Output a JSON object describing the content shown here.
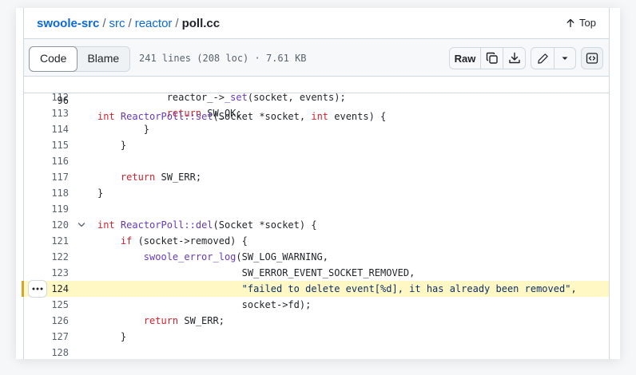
{
  "breadcrumb": {
    "repo": "swoole-src",
    "dir1": "src",
    "dir2": "reactor",
    "file": "poll.cc",
    "separator": "/"
  },
  "top_link": "Top",
  "toolbar": {
    "code_tab": "Code",
    "blame_tab": "Blame",
    "file_meta": "241 lines (208 loc) · 7.61 KB",
    "raw_label": "Raw"
  },
  "icons": [
    "arrow-up-icon",
    "copy-icon",
    "download-icon",
    "pencil-icon",
    "chevron-down-icon",
    "symbols-panel-icon",
    "chevron-down-icon",
    "kebab-dots-icon"
  ],
  "colors": {
    "link": "#0969da",
    "keyword": "#cf222e",
    "function": "#6639ba",
    "string": "#0a3069",
    "highlight_bg": "#fff8c5",
    "highlight_bar": "#d4a72c"
  },
  "sticky_line": {
    "number": "96",
    "tokens": [
      {
        "t": "int",
        "c": "kw"
      },
      {
        "t": " "
      },
      {
        "t": "ReactorPoll::set",
        "c": "fn"
      },
      {
        "t": "(Socket *socket, "
      },
      {
        "t": "int",
        "c": "kw"
      },
      {
        "t": " events) {"
      }
    ]
  },
  "highlighted_line": "124",
  "lines": [
    {
      "number": "112",
      "tokens": [
        {
          "t": "            reactor_->"
        },
        {
          "t": "_set",
          "c": "fn"
        },
        {
          "t": "(socket, events);"
        }
      ]
    },
    {
      "number": "113",
      "tokens": [
        {
          "t": "            "
        },
        {
          "t": "return",
          "c": "kw"
        },
        {
          "t": " SW_OK;"
        }
      ]
    },
    {
      "number": "114",
      "tokens": [
        {
          "t": "        }"
        }
      ]
    },
    {
      "number": "115",
      "tokens": [
        {
          "t": "    }"
        }
      ]
    },
    {
      "number": "116",
      "tokens": []
    },
    {
      "number": "117",
      "tokens": [
        {
          "t": "    "
        },
        {
          "t": "return",
          "c": "kw"
        },
        {
          "t": " SW_ERR;"
        }
      ]
    },
    {
      "number": "118",
      "tokens": [
        {
          "t": "}"
        }
      ]
    },
    {
      "number": "119",
      "tokens": []
    },
    {
      "number": "120",
      "fold": true,
      "tokens": [
        {
          "t": "int",
          "c": "kw"
        },
        {
          "t": " "
        },
        {
          "t": "ReactorPoll::del",
          "c": "fn"
        },
        {
          "t": "(Socket *socket) {"
        }
      ]
    },
    {
      "number": "121",
      "tokens": [
        {
          "t": "    "
        },
        {
          "t": "if",
          "c": "kw"
        },
        {
          "t": " (socket->removed) {"
        }
      ]
    },
    {
      "number": "122",
      "tokens": [
        {
          "t": "        "
        },
        {
          "t": "swoole_error_log",
          "c": "fn"
        },
        {
          "t": "(SW_LOG_WARNING,"
        }
      ]
    },
    {
      "number": "123",
      "tokens": [
        {
          "t": "                         SW_ERROR_EVENT_SOCKET_REMOVED,"
        }
      ]
    },
    {
      "number": "124",
      "tokens": [
        {
          "t": "                         "
        },
        {
          "t": "\"failed to delete event[%d], it has already been removed\"",
          "c": "st"
        },
        {
          "t": ","
        }
      ]
    },
    {
      "number": "125",
      "tokens": [
        {
          "t": "                         socket->fd);"
        }
      ]
    },
    {
      "number": "126",
      "tokens": [
        {
          "t": "        "
        },
        {
          "t": "return",
          "c": "kw"
        },
        {
          "t": " SW_ERR;"
        }
      ]
    },
    {
      "number": "127",
      "tokens": [
        {
          "t": "    }"
        }
      ]
    },
    {
      "number": "128",
      "tokens": []
    }
  ]
}
